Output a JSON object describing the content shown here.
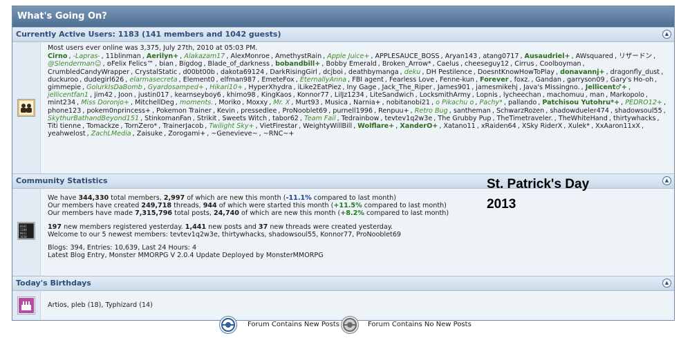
{
  "header": {
    "title": "What's Going On?"
  },
  "active_users": {
    "heading": "Currently Active Users: 1183 (141 members and 1042 guests)",
    "most_online": "Most users ever online was 3,375, July 27th, 2010 at 05:03 PM.",
    "users": [
      {
        "n": "Cirno",
        "s": "b"
      },
      {
        "n": "-Lapras-",
        "s": "gi"
      },
      {
        "n": "11blinman"
      },
      {
        "n": "Aerilyn+",
        "s": "b"
      },
      {
        "n": "Alakazam17",
        "s": "gi"
      },
      {
        "n": "AlexMonroe"
      },
      {
        "n": "AmethystRain"
      },
      {
        "n": "Apple Juice+",
        "s": "gi"
      },
      {
        "n": "APPLESAUCE_BOSS"
      },
      {
        "n": "Aryan143"
      },
      {
        "n": "atang0717"
      },
      {
        "n": "Ausaudriel+",
        "s": "b"
      },
      {
        "n": "AWsquared"
      },
      {
        "n": "リザードン"
      },
      {
        "n": "@Slenderman☺",
        "s": "gi"
      },
      {
        "n": "ʚFelix Felics™"
      },
      {
        "n": "bian"
      },
      {
        "n": "Bigdog"
      },
      {
        "n": "Blade_of_darkness"
      },
      {
        "n": "bobandbill+",
        "s": "b"
      },
      {
        "n": "Bobby Emerald"
      },
      {
        "n": "Broken_Arrow*"
      },
      {
        "n": "Caelus"
      },
      {
        "n": "cheeseguy12"
      },
      {
        "n": "Cirrus"
      },
      {
        "n": "Coolboyman"
      },
      {
        "n": "CrumbledCandyWrapper"
      },
      {
        "n": "CrystalStatic"
      },
      {
        "n": "d00bt00b"
      },
      {
        "n": "dakota69124"
      },
      {
        "n": "DarkRisingGirl"
      },
      {
        "n": "dcjboi"
      },
      {
        "n": "deathbymanga"
      },
      {
        "n": "deku",
        "s": "gi"
      },
      {
        "n": "DH Pestilence"
      },
      {
        "n": "DoesntKnowHowToPlay"
      },
      {
        "n": "donavannj+",
        "s": "b"
      },
      {
        "n": "dragonfly_dust"
      },
      {
        "n": "duckuroo"
      },
      {
        "n": "dudegirl626"
      },
      {
        "n": "elarmasecreta",
        "s": "gi"
      },
      {
        "n": "Element0"
      },
      {
        "n": "elfman987"
      },
      {
        "n": "EmeteFox"
      },
      {
        "n": "EternallyAnna",
        "s": "gi"
      },
      {
        "n": "FBI agent"
      },
      {
        "n": "Fearless Love"
      },
      {
        "n": "Fenne-kun"
      },
      {
        "n": "Forever",
        "s": "b"
      },
      {
        "n": "foxz."
      },
      {
        "n": "Gandan"
      },
      {
        "n": "garryson09"
      },
      {
        "n": "Gary's Ho-oh"
      },
      {
        "n": "gimmepie"
      },
      {
        "n": "GolurkIsDaBomb",
        "s": "gi"
      },
      {
        "n": "Gyardosamped+",
        "s": "gi"
      },
      {
        "n": "Hikari10+",
        "s": "gi"
      },
      {
        "n": "HyperXhydra"
      },
      {
        "n": "iLike2EatPiez"
      },
      {
        "n": "Iny Gage"
      },
      {
        "n": "Jack_The_Riper"
      },
      {
        "n": "James901"
      },
      {
        "n": "jamesmikehj"
      },
      {
        "n": "Java's Missingno."
      },
      {
        "n": "Jellicent♂+",
        "s": "b"
      },
      {
        "n": "jellicentfan1",
        "s": "gi"
      },
      {
        "n": "jim42"
      },
      {
        "n": "Joon"
      },
      {
        "n": "justin017"
      },
      {
        "n": "kearnseyboy6"
      },
      {
        "n": "khimo98"
      },
      {
        "n": "KingKaos"
      },
      {
        "n": "Konnor77"
      },
      {
        "n": "LilJz1234"
      },
      {
        "n": "LiteSandwich"
      },
      {
        "n": "LocksmithArmy"
      },
      {
        "n": "Lopnis"
      },
      {
        "n": "lycheechan"
      },
      {
        "n": "machomuu"
      },
      {
        "n": "man"
      },
      {
        "n": "Markopolo"
      },
      {
        "n": "mint234"
      },
      {
        "n": "Miss Doronjo+",
        "s": "gi"
      },
      {
        "n": "MitchellDeg"
      },
      {
        "n": "moments.",
        "s": "gi"
      },
      {
        "n": "Moriko"
      },
      {
        "n": "Moxxy"
      },
      {
        "n": "Mr. X",
        "s": "gi"
      },
      {
        "n": "Murt93"
      },
      {
        "n": "Musica"
      },
      {
        "n": "Narnia+"
      },
      {
        "n": "nobitanobi21"
      },
      {
        "n": "o Pikachu o",
        "s": "gi"
      },
      {
        "n": "Pachy*",
        "s": "gi"
      },
      {
        "n": "pallando"
      },
      {
        "n": "Patchisou Yutohru*+",
        "s": "b"
      },
      {
        "n": "PEDRO12+",
        "s": "gi"
      },
      {
        "n": "phone123"
      },
      {
        "n": "pokem0nprincess+"
      },
      {
        "n": "Pokemon Trainer"
      },
      {
        "n": "Kevin"
      },
      {
        "n": "pressedlee"
      },
      {
        "n": "ProNooblet69"
      },
      {
        "n": "purnell1996"
      },
      {
        "n": "Renpuu+"
      },
      {
        "n": "Retro Bug",
        "s": "gi"
      },
      {
        "n": "santheman"
      },
      {
        "n": "SchwarzRozen"
      },
      {
        "n": "shadowdueler474"
      },
      {
        "n": "shadowsoul55"
      },
      {
        "n": "SkythurBathandBeyond151",
        "s": "gi"
      },
      {
        "n": "StinkomanFan"
      },
      {
        "n": "Strikit"
      },
      {
        "n": "Sweets Witch"
      },
      {
        "n": "tabor62"
      },
      {
        "n": "Team Fail",
        "s": "gi"
      },
      {
        "n": "Tedrainbow"
      },
      {
        "n": "tevtev1q2w3e"
      },
      {
        "n": "The Grubby Pup"
      },
      {
        "n": "TheTimetraveler."
      },
      {
        "n": "TheWhiteHand"
      },
      {
        "n": "thirtywhacks"
      },
      {
        "n": "Titi tienne"
      },
      {
        "n": "Tomackze"
      },
      {
        "n": "TornZero*"
      },
      {
        "n": "TrainerJacob"
      },
      {
        "n": "Twilight Sky+",
        "s": "gi"
      },
      {
        "n": "VietFirestar"
      },
      {
        "n": "WeightyWillBill"
      },
      {
        "n": "Wolflare+",
        "s": "b"
      },
      {
        "n": "XanderO+",
        "s": "b"
      },
      {
        "n": "Xatano11"
      },
      {
        "n": "xRaiden64"
      },
      {
        "n": "XSky RiderX"
      },
      {
        "n": "Xulek*"
      },
      {
        "n": "XxAaron11xX"
      },
      {
        "n": "yeahwelost"
      },
      {
        "n": "ZachLMedia",
        "s": "gi"
      },
      {
        "n": "Zaisuke"
      },
      {
        "n": "Zorogami+"
      },
      {
        "n": "~Genevieve~"
      },
      {
        "n": "~RNC~+",
        "last": true
      }
    ]
  },
  "stats": {
    "heading": "Community Statistics",
    "line1": {
      "a": "We have ",
      "members": "344,330",
      "b": " total members, ",
      "new": "2,997",
      "c": " of which are new this month (",
      "pct": "-11.1%",
      "d": " compared to last month)"
    },
    "line2": {
      "a": "Our members have created ",
      "threads": "249,718",
      "b": " threads, ",
      "new": "944",
      "c": " of which were started this month (",
      "pct": "+11.5%",
      "d": " compared to last month)"
    },
    "line3": {
      "a": "Our members have made ",
      "posts": "7,315,796",
      "b": " total posts, ",
      "new": "24,740",
      "c": " of which are new this month (",
      "pct": "+8.2%",
      "d": " compared to last month)"
    },
    "yesterday": {
      "reg": "197",
      "a": " new members registered yesterday. ",
      "posts": "1,441",
      "b": " new posts and ",
      "threads": "37",
      "c": " new threads were created yesterday."
    },
    "newest": "Welcome to our 5 newest members: tevtev1q2w3e, thirtywhacks, shadowsoul55, Konnor77, ProNooblet69",
    "blogs": "Blogs: 394, Entries: 10,639, Last 24 Hours: 4",
    "latest_blog": "Latest Blog Entry, Monster MMORPG V 2.0.4 Update Deployed by MonsterMMORPG",
    "banner_line1": "St. Patrick's Day",
    "banner_line2": "2013"
  },
  "birthdays": {
    "heading": "Today's Birthdays",
    "text": "Artios, pleb (18), Typhizard (14)"
  },
  "legend": {
    "new_posts": "Forum Contains New Posts",
    "no_new_posts": "Forum Contains No New Posts"
  },
  "colors": {
    "header": "#4e6f93",
    "green_name": "#2d6a1e",
    "negative": "#1a3fa8",
    "positive": "#1f7a1f"
  },
  "icons": [
    "collapse-icon",
    "users-icon",
    "stats-icon",
    "birthday-cake-icon",
    "new-posts-icon",
    "no-new-posts-icon"
  ]
}
